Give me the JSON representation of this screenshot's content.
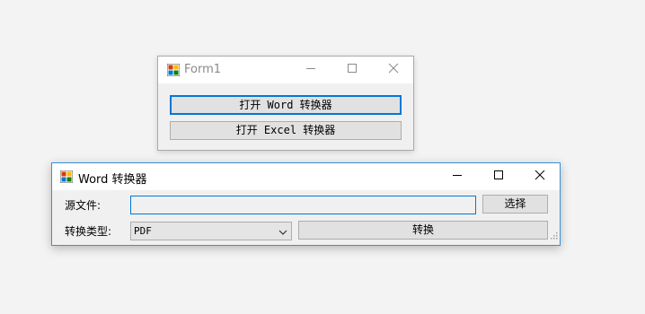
{
  "form1": {
    "title": "Form1",
    "minimize_icon": "minimize-icon",
    "maximize_icon": "maximize-icon",
    "close_icon": "close-icon",
    "open_word_button": "打开 Word 转换器",
    "open_excel_button": "打开 Excel 转换器"
  },
  "word_converter": {
    "title": "Word 转换器",
    "source_file_label": "源文件:",
    "source_file_value": "",
    "browse_button": "选择",
    "convert_type_label": "转换类型:",
    "convert_type_value": "PDF",
    "convert_button": "转换"
  },
  "colors": {
    "accent": "#0078d7",
    "window_bg": "#f0f0f0",
    "button_bg": "#e1e1e1",
    "desktop_bg": "#f3f3f3"
  }
}
